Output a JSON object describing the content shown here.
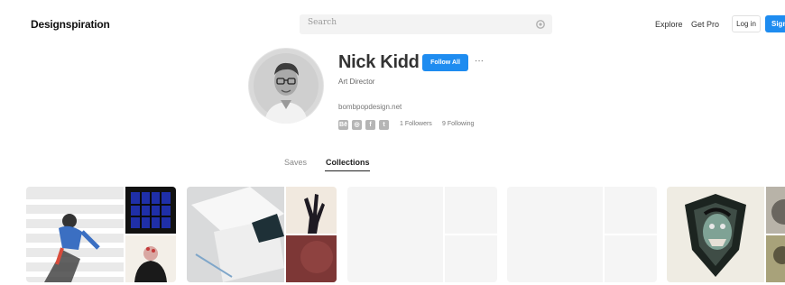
{
  "header": {
    "logo": "Designspiration",
    "search_placeholder": "Search",
    "nav": [
      "Explore",
      "Get Pro"
    ],
    "login": "Log in",
    "signup": "Sign"
  },
  "profile": {
    "name": "Nick Kidd",
    "follow_label": "Follow All",
    "more_label": "···",
    "role": "Art Director",
    "website": "bombpopdesign.net",
    "social_icons": [
      "behance-icon",
      "instagram-icon",
      "facebook-icon",
      "twitter-icon"
    ],
    "social_glyphs": [
      "Bē",
      "◎",
      "f",
      "t"
    ],
    "followers": "1 Followers",
    "following": "9 Following"
  },
  "tabs": [
    "Saves",
    "Collections"
  ],
  "colors": {
    "accent": "#1e8cf0",
    "placeholder": "#f5f5f5"
  }
}
